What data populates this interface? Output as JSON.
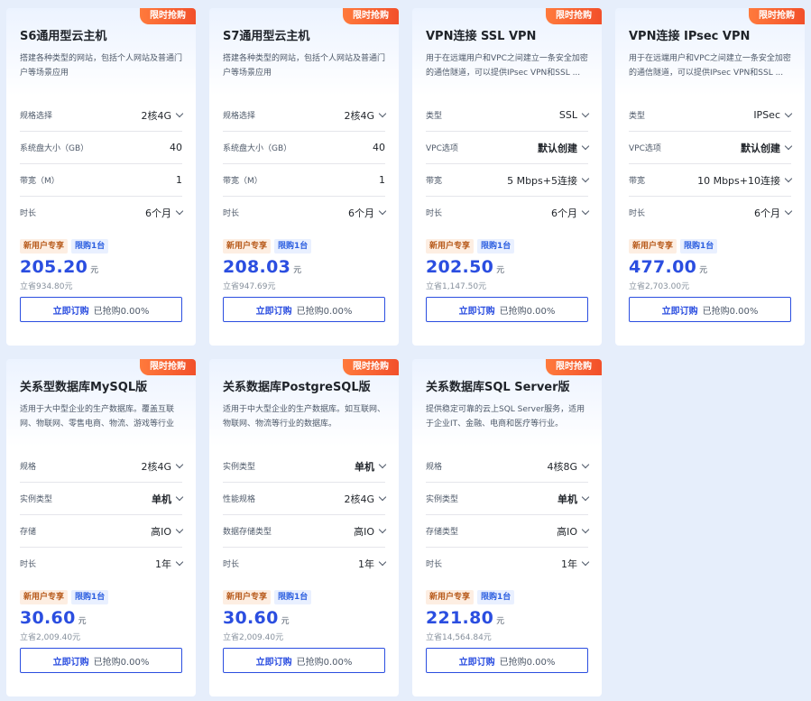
{
  "cards": [
    {
      "promo": "限时抢购",
      "title": "S6通用型云主机",
      "desc": "搭建各种类型的网站，包括个人网站及普通门户等场景应用",
      "specs": [
        {
          "label": "规格选择",
          "value": "2核4G",
          "dropdown": true,
          "bold": false
        },
        {
          "label": "系统盘大小（GB）",
          "value": "40",
          "dropdown": false,
          "bold": false
        },
        {
          "label": "带宽（M）",
          "value": "1",
          "dropdown": false,
          "bold": false
        },
        {
          "label": "时长",
          "value": "6个月",
          "dropdown": true,
          "bold": false
        }
      ],
      "tags": [
        "新用户专享",
        "限购1台"
      ],
      "price": "205.20",
      "unit": "元",
      "save": "立省934.80元",
      "buy_label": "立即订购",
      "sold": "已抢购0.00%"
    },
    {
      "promo": "限时抢购",
      "title": "S7通用型云主机",
      "desc": "搭建各种类型的网站，包括个人网站及普通门户等场景应用",
      "specs": [
        {
          "label": "规格选择",
          "value": "2核4G",
          "dropdown": true,
          "bold": false
        },
        {
          "label": "系统盘大小（GB）",
          "value": "40",
          "dropdown": false,
          "bold": false
        },
        {
          "label": "带宽（M）",
          "value": "1",
          "dropdown": false,
          "bold": false
        },
        {
          "label": "时长",
          "value": "6个月",
          "dropdown": true,
          "bold": false
        }
      ],
      "tags": [
        "新用户专享",
        "限购1台"
      ],
      "price": "208.03",
      "unit": "元",
      "save": "立省947.69元",
      "buy_label": "立即订购",
      "sold": "已抢购0.00%"
    },
    {
      "promo": "限时抢购",
      "title": "VPN连接 SSL VPN",
      "desc": "用于在远端用户和VPC之间建立一条安全加密的通信隧道，可以提供IPsec VPN和SSL ...",
      "specs": [
        {
          "label": "类型",
          "value": "SSL",
          "dropdown": true,
          "bold": false
        },
        {
          "label": "VPC选项",
          "value": "默认创建",
          "dropdown": true,
          "bold": true
        },
        {
          "label": "带宽",
          "value": "5 Mbps+5连接",
          "dropdown": true,
          "bold": false
        },
        {
          "label": "时长",
          "value": "6个月",
          "dropdown": true,
          "bold": false
        }
      ],
      "tags": [
        "新用户专享",
        "限购1台"
      ],
      "price": "202.50",
      "unit": "元",
      "save": "立省1,147.50元",
      "buy_label": "立即订购",
      "sold": "已抢购0.00%"
    },
    {
      "promo": "限时抢购",
      "title": "VPN连接 IPsec VPN",
      "desc": "用于在远端用户和VPC之间建立一条安全加密的通信隧道，可以提供IPsec VPN和SSL ...",
      "specs": [
        {
          "label": "类型",
          "value": "IPSec",
          "dropdown": true,
          "bold": false
        },
        {
          "label": "VPC选项",
          "value": "默认创建",
          "dropdown": true,
          "bold": true
        },
        {
          "label": "带宽",
          "value": "10 Mbps+10连接",
          "dropdown": true,
          "bold": false
        },
        {
          "label": "时长",
          "value": "6个月",
          "dropdown": true,
          "bold": false
        }
      ],
      "tags": [
        "新用户专享",
        "限购1台"
      ],
      "price": "477.00",
      "unit": "元",
      "save": "立省2,703.00元",
      "buy_label": "立即订购",
      "sold": "已抢购0.00%"
    },
    {
      "promo": "限时抢购",
      "title": "关系型数据库MySQL版",
      "desc": "适用于大中型企业的生产数据库。覆盖互联网、物联网、零售电商、物流、游戏等行业",
      "specs": [
        {
          "label": "规格",
          "value": "2核4G",
          "dropdown": true,
          "bold": false
        },
        {
          "label": "实例类型",
          "value": "单机",
          "dropdown": true,
          "bold": true
        },
        {
          "label": "存储",
          "value": "高IO",
          "dropdown": true,
          "bold": false
        },
        {
          "label": "时长",
          "value": "1年",
          "dropdown": true,
          "bold": false
        }
      ],
      "tags": [
        "新用户专享",
        "限购1台"
      ],
      "price": "30.60",
      "unit": "元",
      "save": "立省2,009.40元",
      "buy_label": "立即订购",
      "sold": "已抢购0.00%"
    },
    {
      "promo": "限时抢购",
      "title": "关系数据库PostgreSQL版",
      "desc": "适用于中大型企业的生产数据库。如互联网、物联网、物流等行业的数据库。",
      "specs": [
        {
          "label": "实例类型",
          "value": "单机",
          "dropdown": true,
          "bold": true
        },
        {
          "label": "性能规格",
          "value": "2核4G",
          "dropdown": true,
          "bold": false
        },
        {
          "label": "数据存储类型",
          "value": "高IO",
          "dropdown": true,
          "bold": false
        },
        {
          "label": "时长",
          "value": "1年",
          "dropdown": true,
          "bold": false
        }
      ],
      "tags": [
        "新用户专享",
        "限购1台"
      ],
      "price": "30.60",
      "unit": "元",
      "save": "立省2,009.40元",
      "buy_label": "立即订购",
      "sold": "已抢购0.00%"
    },
    {
      "promo": "限时抢购",
      "title": "关系数据库SQL Server版",
      "desc": "提供稳定可靠的云上SQL Server服务，适用于企业IT、金融、电商和医疗等行业。",
      "specs": [
        {
          "label": "规格",
          "value": "4核8G",
          "dropdown": true,
          "bold": false
        },
        {
          "label": "实例类型",
          "value": "单机",
          "dropdown": true,
          "bold": true
        },
        {
          "label": "存储类型",
          "value": "高IO",
          "dropdown": true,
          "bold": false
        },
        {
          "label": "时长",
          "value": "1年",
          "dropdown": true,
          "bold": false
        }
      ],
      "tags": [
        "新用户专享",
        "限购1台"
      ],
      "price": "221.80",
      "unit": "元",
      "save": "立省14,564.84元",
      "buy_label": "立即订购",
      "sold": "已抢购0.00%"
    }
  ]
}
